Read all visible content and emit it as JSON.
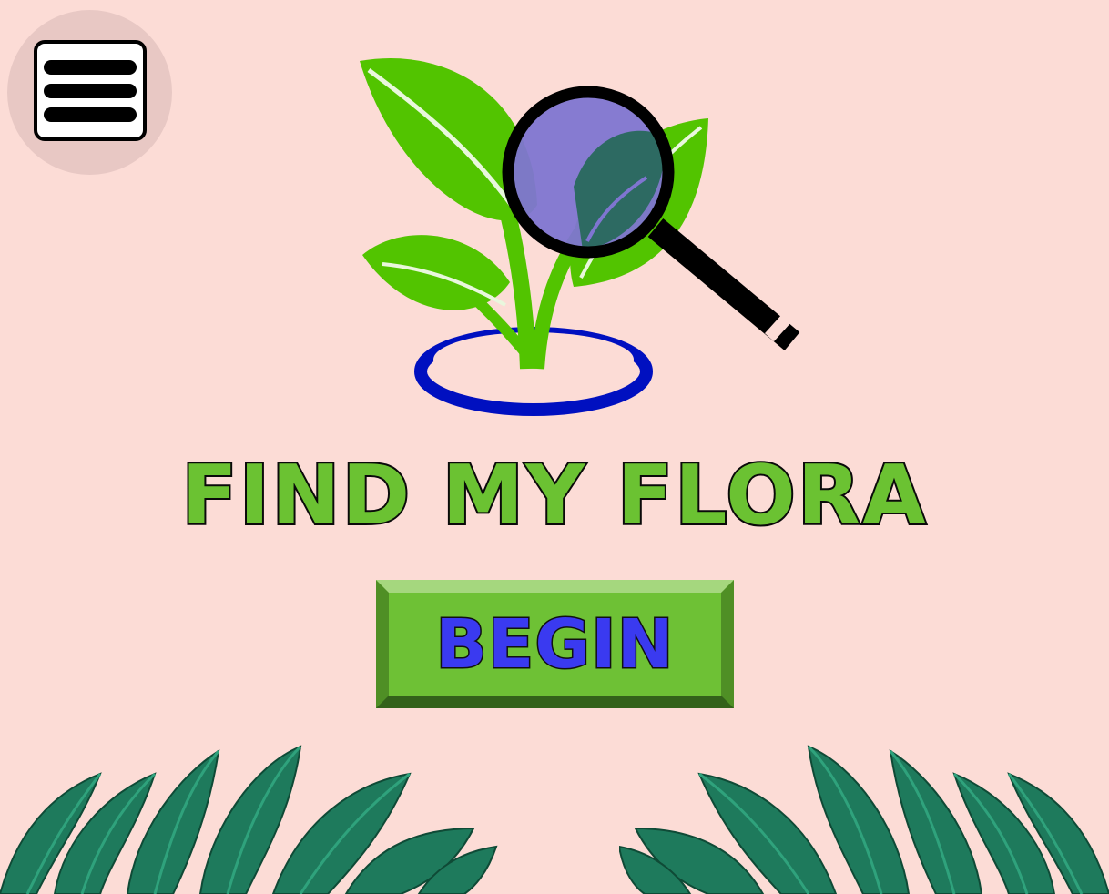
{
  "app": {
    "title": "FIND MY FLORA",
    "begin_label": "BEGIN"
  },
  "icons": {
    "menu": "hamburger-menu-icon",
    "logo": "plant-magnifier-logo",
    "decoration": "tropical-leaves"
  },
  "colors": {
    "background": "#fcdcd6",
    "title_fill": "#6bc232",
    "button_fill": "#6ec135",
    "button_text": "#3a3af0",
    "leaf_green": "#52c400",
    "lens_purple": "#7f75d1",
    "ring_blue": "#0010c0",
    "foliage": "#1e7a5c"
  }
}
